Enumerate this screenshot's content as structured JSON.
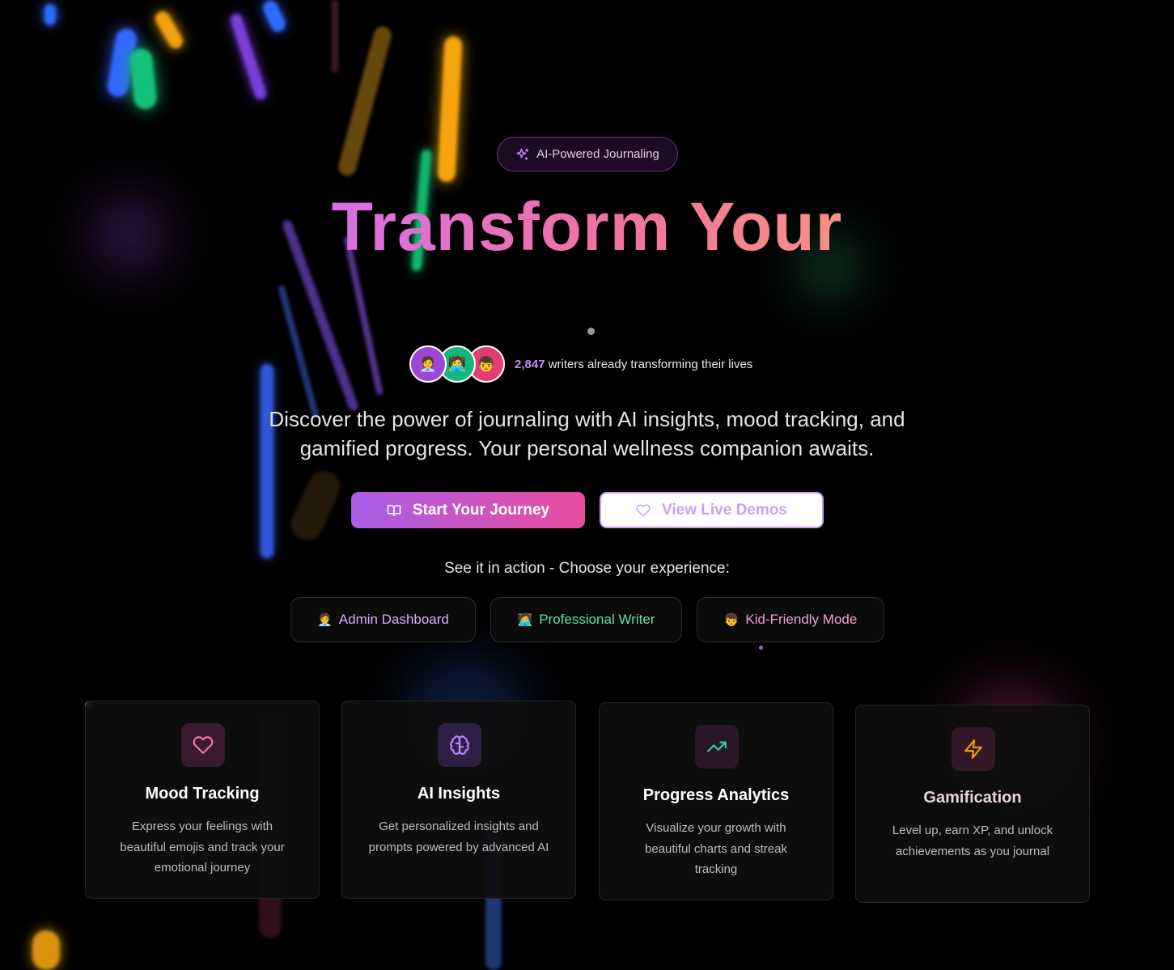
{
  "badge": {
    "label": "AI-Powered Journaling",
    "icon": "sparkles-icon"
  },
  "headline": "Transform Your",
  "social_proof": {
    "avatars": [
      "🧑‍💼",
      "🧑‍💻",
      "👦"
    ],
    "count": "2,847",
    "text": " writers already transforming their lives"
  },
  "subtitle": "Discover the power of journaling with AI insights, mood tracking, and gamified progress. Your personal wellness companion awaits.",
  "cta": {
    "primary": {
      "label": "Start Your Journey",
      "icon": "book-open-icon"
    },
    "secondary": {
      "label": "View Live Demos",
      "icon": "heart-icon"
    }
  },
  "experience": {
    "prompt": "See it in action - Choose your experience:",
    "modes": [
      {
        "emoji": "🧑‍💼",
        "label": "Admin Dashboard",
        "color": "#d0b0f5"
      },
      {
        "emoji": "🧑‍💻",
        "label": "Professional Writer",
        "color": "#5fdfa3"
      },
      {
        "emoji": "👦",
        "label": "Kid-Friendly Mode",
        "color": "#f2a0cf"
      }
    ]
  },
  "features": [
    {
      "title": "Mood Tracking",
      "description": "Express your feelings with beautiful emojis and track your emotional journey",
      "icon": "heart-icon",
      "color": "#f472b6"
    },
    {
      "title": "AI Insights",
      "description": "Get personalized insights and prompts powered by advanced AI",
      "icon": "brain-icon",
      "color": "#c084fc"
    },
    {
      "title": "Progress Analytics",
      "description": "Visualize your growth with beautiful charts and streak tracking",
      "icon": "trending-up-icon",
      "color": "#34d399"
    },
    {
      "title": "Gamification",
      "description": "Level up, earn XP, and unlock achievements as you journal",
      "icon": "zap-icon",
      "color": "#f59e0b"
    }
  ]
}
